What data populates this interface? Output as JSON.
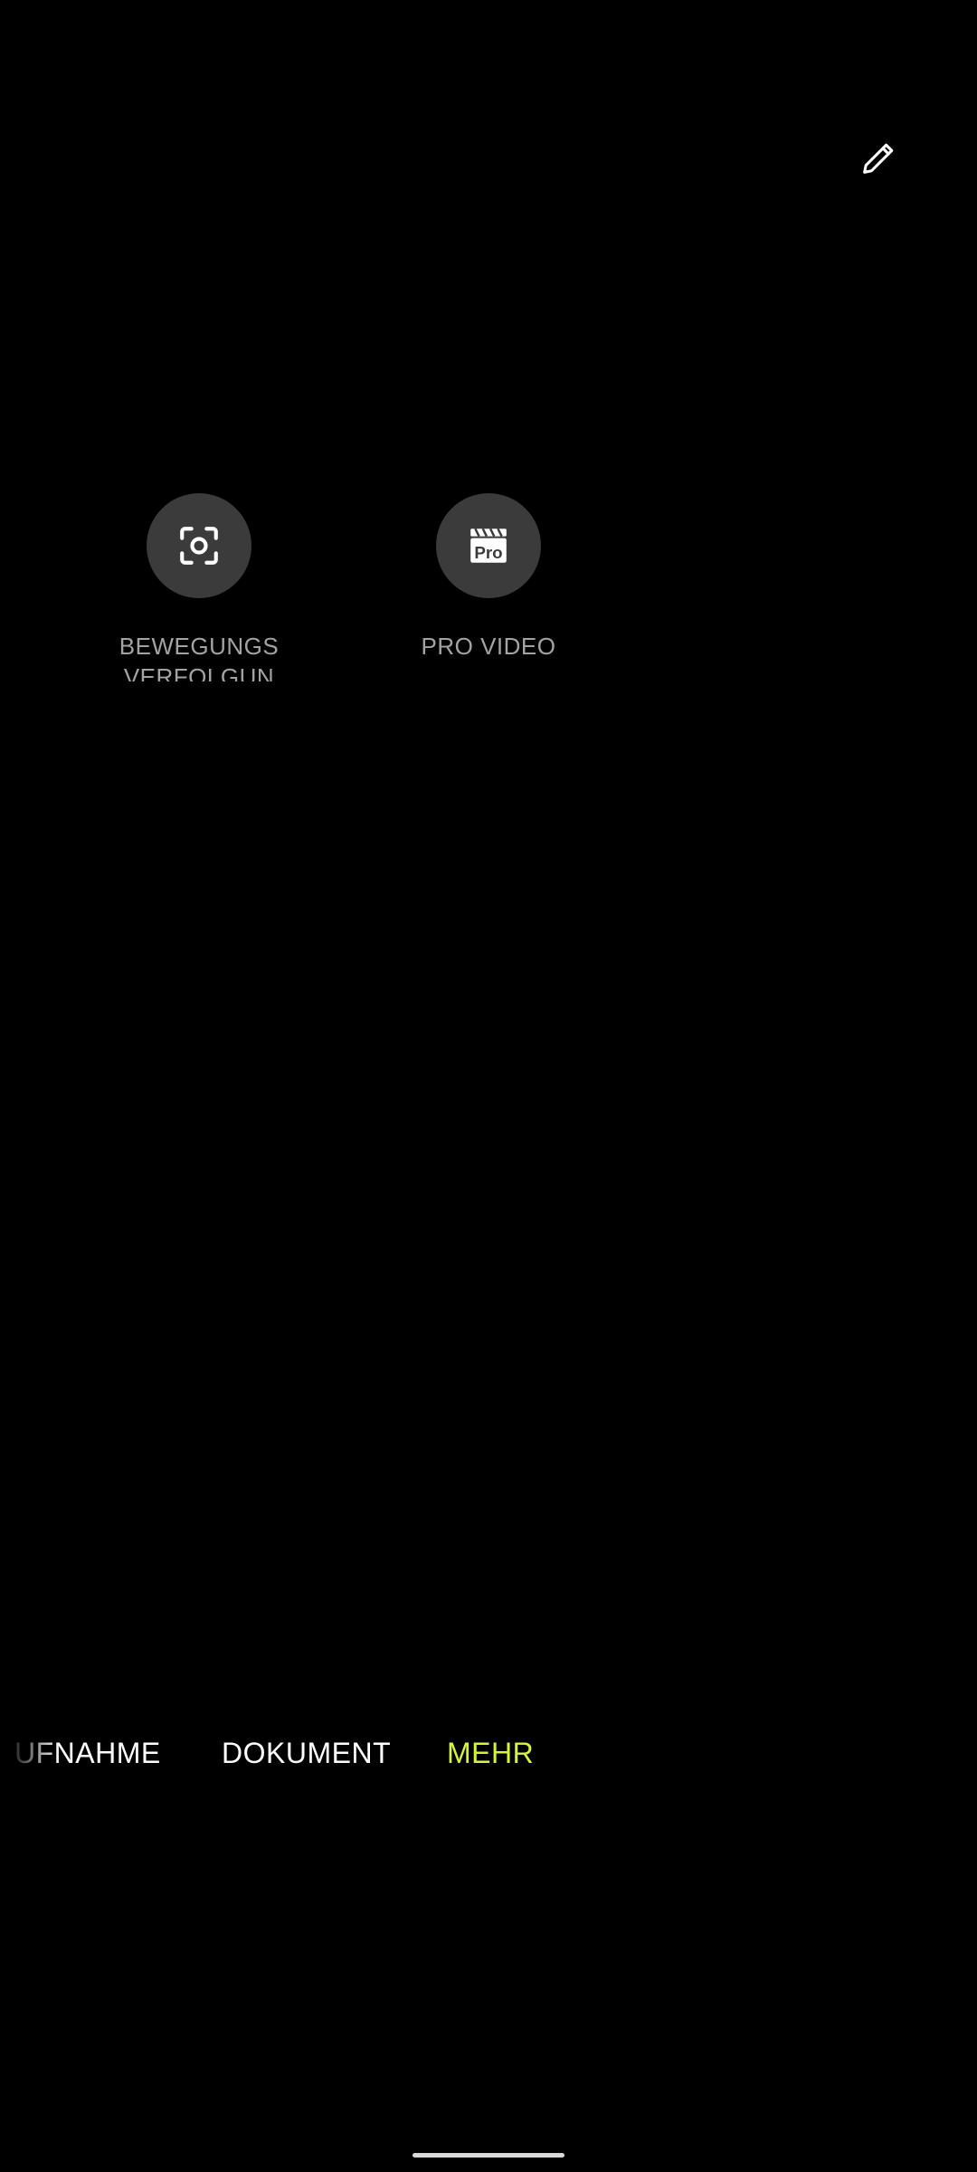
{
  "toolbar": {
    "edit_icon": "pencil-icon"
  },
  "modes": [
    {
      "label": "BEWEGUNGS VERFOLGUN G",
      "icon": "motion-tracking-frame-icon"
    },
    {
      "label": "PRO VIDEO",
      "icon": "pro-video-clapper-icon",
      "icon_text": "Pro"
    }
  ],
  "tabs": [
    {
      "label": "UFNAHME",
      "state": "partially-visible"
    },
    {
      "label": "DOKUMENT",
      "state": "inactive"
    },
    {
      "label": "MEHR",
      "state": "active"
    }
  ],
  "colors": {
    "background": "#000000",
    "tile_circle": "#3b3b3b",
    "label_gray": "#a3a3a3",
    "active_accent": "#d4f53c",
    "tab_text": "#ffffff"
  }
}
